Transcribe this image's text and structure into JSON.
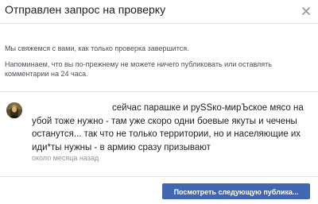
{
  "dialog": {
    "title": "Отправлен запрос на проверку",
    "info_review": "Мы свяжемся с вами, как только проверка завершится.",
    "info_reminder": "Напоминаем, что вы по-прежнему не можете ничего публиковать или оставлять комментарии на 24 часа."
  },
  "comment": {
    "text": "сейчас парашке и руSSко-мирЪское мясо на убой тоже нужно - там уже скоро одни боевые якуты и чечены останутся... так что не только территории, но и населяющие их иди*ты нужны - в армию сразу призывают",
    "timestamp": "около месяца назад"
  },
  "footer": {
    "next_button_label": "Посмотреть следующую публика..."
  },
  "icons": {
    "close": "close-icon",
    "avatar": "avatar"
  },
  "colors": {
    "primary_button": "#4267b2",
    "text_primary": "#1c1e21",
    "text_secondary": "#4b4f56",
    "timestamp": "#90949c"
  }
}
